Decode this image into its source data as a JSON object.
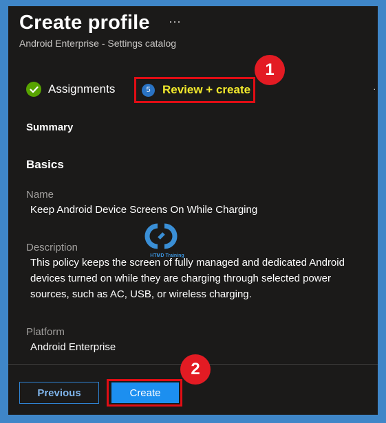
{
  "header": {
    "title": "Create profile",
    "more_label": "···",
    "subtitle": "Android Enterprise - Settings catalog"
  },
  "steps": {
    "assignments": {
      "label": "Assignments",
      "icon": "check-circle-icon",
      "status": "completed"
    },
    "review": {
      "number": "5",
      "label": "Review + create",
      "status": "current"
    }
  },
  "callouts": {
    "first": "1",
    "second": "2"
  },
  "summary": {
    "heading": "Summary",
    "basics_heading": "Basics",
    "name_label": "Name",
    "name_value": "Keep Android Device Screens On While Charging",
    "description_label": "Description",
    "description_value": "This policy keeps the screen of fully managed and dedicated Android devices turned on while they are charging through selected power sources, such as AC, USB, or wireless charging.",
    "platform_label": "Platform",
    "platform_value": "Android Enterprise"
  },
  "watermark": {
    "text": "HTMD Training"
  },
  "footer": {
    "previous_label": "Previous",
    "create_label": "Create"
  },
  "colors": {
    "frame": "#3f86c8",
    "panel": "#1b1a19",
    "highlight": "#e00d14",
    "review_text": "#f2e92c",
    "primary_button": "#1c8ff0",
    "check": "#57a300"
  }
}
